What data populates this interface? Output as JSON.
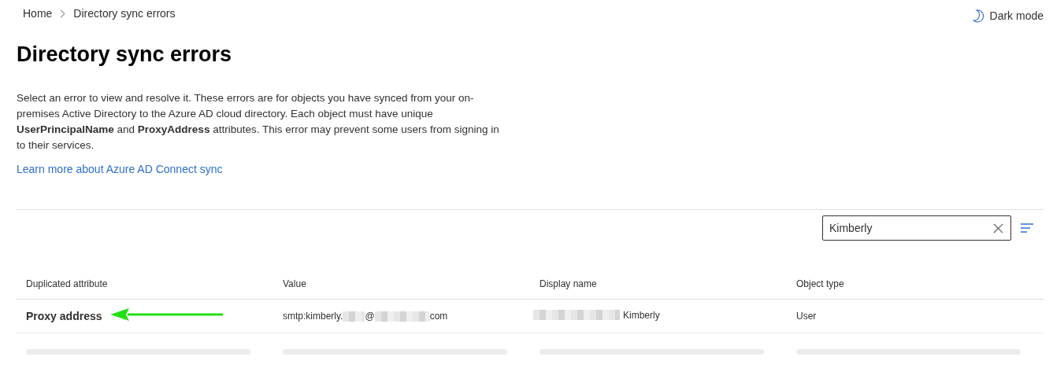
{
  "breadcrumb": [
    {
      "label": "Home"
    },
    {
      "label": "Directory sync errors"
    }
  ],
  "dark_mode": {
    "label": "Dark mode"
  },
  "title": "Directory sync errors",
  "description": "Select an error to view and resolve it. These errors are for objects you have synced from your on-premises Active Directory to the Azure AD cloud directory. Each object must have unique **UserPrincipalName** and **ProxyAddress** attributes. This error may prevent some users from signing in to their services.",
  "learn_more_link": "Learn more about Azure AD Connect sync",
  "search": {
    "value": "Kimberly"
  },
  "table": {
    "columns": [
      "Duplicated attribute",
      "Value",
      "Display name",
      "Object type"
    ],
    "rows": [
      {
        "kind": "data",
        "arrow": true,
        "cells": [
          [
            {
              "kind": "text",
              "text": "Proxy address"
            }
          ],
          [
            {
              "kind": "text",
              "text": "smtp:kimberly."
            },
            {
              "kind": "redacted"
            },
            {
              "kind": "text",
              "text": "@"
            },
            {
              "kind": "redacted"
            },
            {
              "kind": "text",
              "text": "com"
            }
          ],
          [
            {
              "kind": "redacted"
            },
            {
              "kind": "text",
              "text": "Kimberly"
            }
          ],
          [
            {
              "kind": "text",
              "text": "User"
            }
          ]
        ]
      },
      {
        "kind": "skeleton"
      }
    ]
  }
}
